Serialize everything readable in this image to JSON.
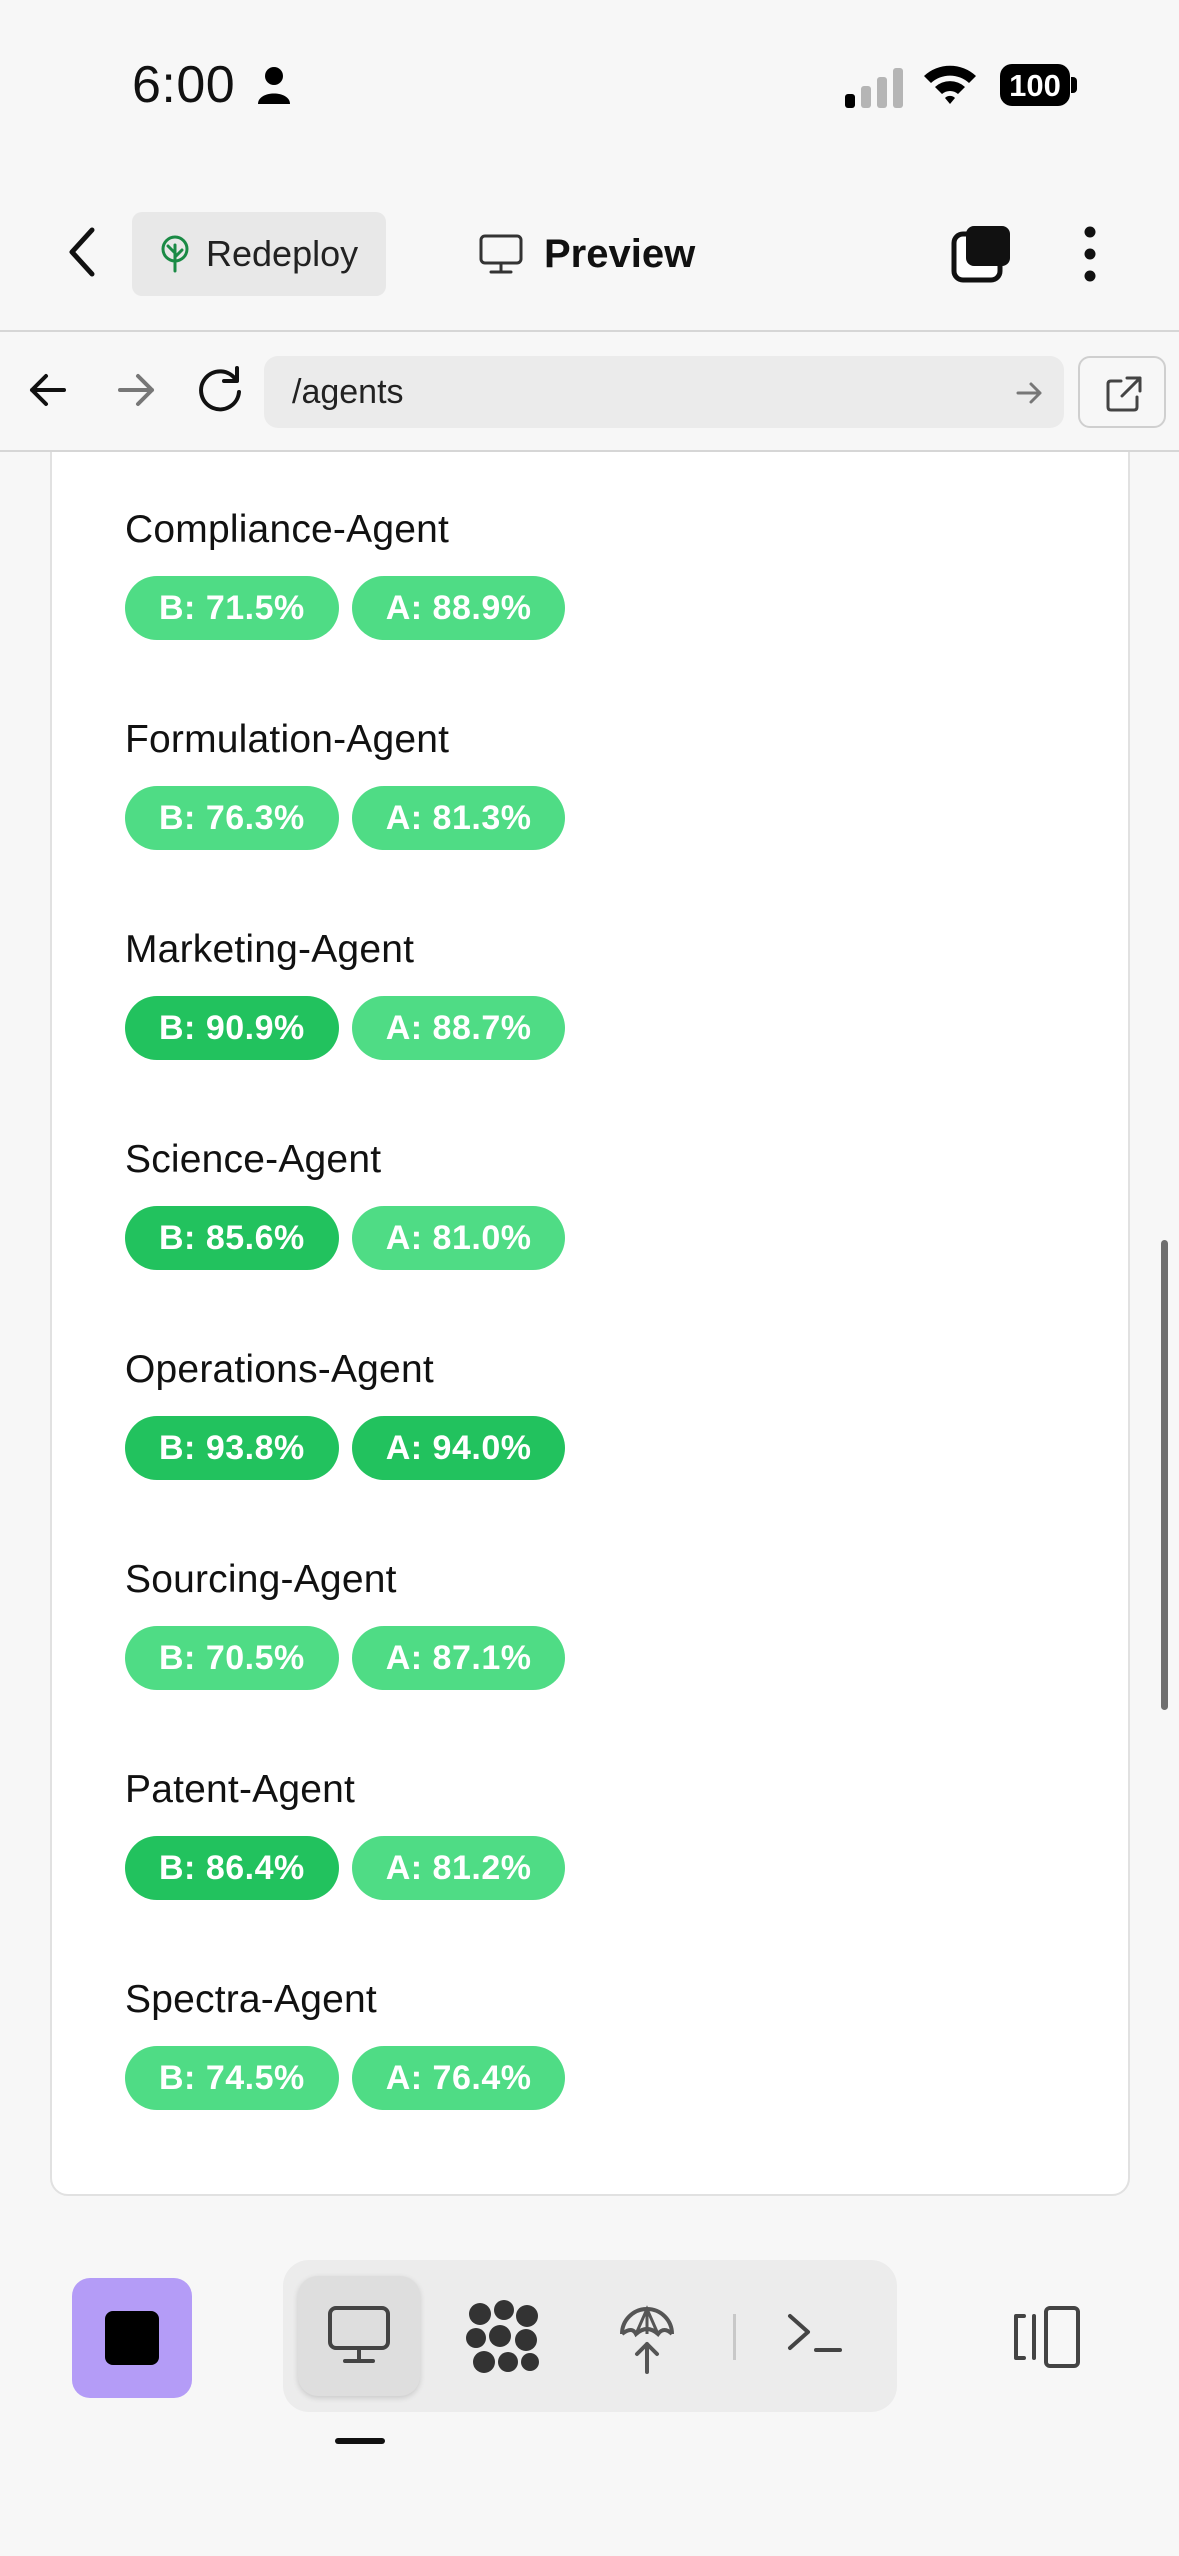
{
  "status_bar": {
    "time": "6:00",
    "battery": "100"
  },
  "header": {
    "redeploy_label": "Redeploy",
    "preview_label": "Preview"
  },
  "urlbar": {
    "url": "/agents"
  },
  "agents": [
    {
      "name": "Compliance-Agent",
      "before": "B: 71.5%",
      "after": "A: 88.9%"
    },
    {
      "name": "Formulation-Agent",
      "before": "B: 76.3%",
      "after": "A: 81.3%"
    },
    {
      "name": "Marketing-Agent",
      "before": "B: 90.9%",
      "after": "A: 88.7%"
    },
    {
      "name": "Science-Agent",
      "before": "B: 85.6%",
      "after": "A: 81.0%"
    },
    {
      "name": "Operations-Agent",
      "before": "B: 93.8%",
      "after": "A: 94.0%"
    },
    {
      "name": "Sourcing-Agent",
      "before": "B: 70.5%",
      "after": "A: 87.1%"
    },
    {
      "name": "Patent-Agent",
      "before": "B: 86.4%",
      "after": "A: 81.2%"
    },
    {
      "name": "Spectra-Agent",
      "before": "B: 74.5%",
      "after": "A: 76.4%"
    }
  ],
  "colors": {
    "badge_light": "#4fdc85",
    "badge_dark": "#22c25e",
    "stop_button": "#b49cf7"
  },
  "icons": {
    "status": [
      "person-icon",
      "signal-icon",
      "wifi-icon",
      "battery-icon"
    ],
    "header": [
      "chevron-left-icon",
      "tree-icon",
      "monitor-icon",
      "tabs-icon",
      "more-vertical-icon"
    ],
    "urlbar": [
      "arrow-left-icon",
      "arrow-right-icon",
      "reload-icon",
      "arrow-go-icon",
      "external-link-icon"
    ],
    "bottom": [
      "stop-icon",
      "monitor-icon",
      "dots-cluster-icon",
      "deploy-icon",
      "terminal-icon",
      "layout-panel-icon"
    ]
  }
}
